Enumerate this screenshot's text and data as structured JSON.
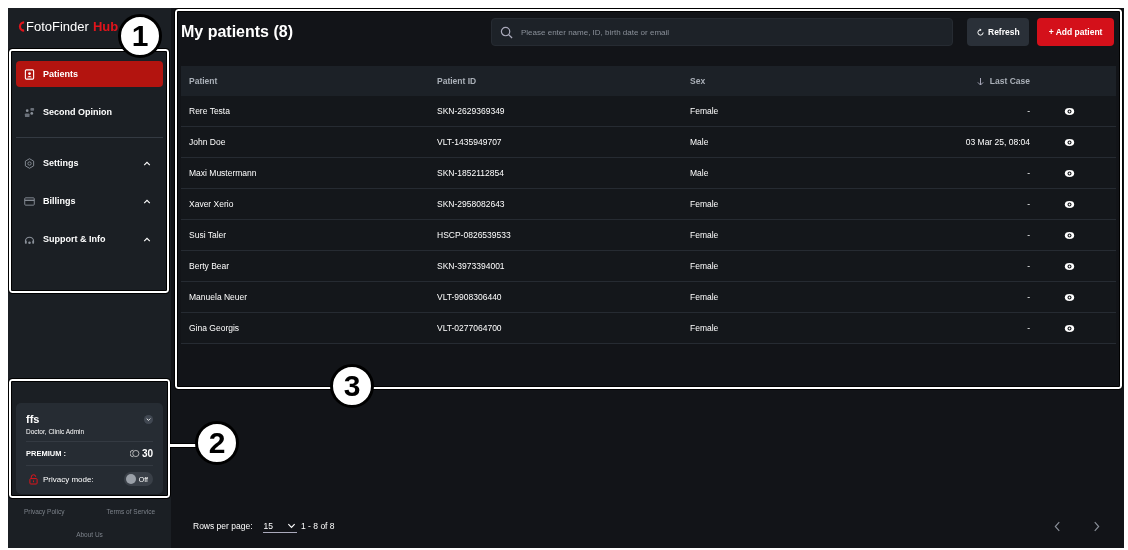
{
  "logo": {
    "brand": "FotoFinder",
    "accent": "Hub"
  },
  "nav": [
    {
      "label": "Patients",
      "selected": true,
      "chevron": false
    },
    {
      "label": "Second Opinion",
      "selected": false,
      "chevron": false
    },
    {
      "label": "Settings",
      "selected": false,
      "chevron": true
    },
    {
      "label": "Billings",
      "selected": false,
      "chevron": true
    },
    {
      "label": "Support & Info",
      "selected": false,
      "chevron": true
    }
  ],
  "profile": {
    "name": "ffs",
    "role": "Doctor, Clinic Admin",
    "plan": "PREMIUM :",
    "credits": "30",
    "privacy_label": "Privacy mode:",
    "privacy_on": false,
    "privacy_state": "Off"
  },
  "footer_links": [
    "Privacy Policy",
    "Terms of Service",
    "About Us"
  ],
  "title": "My patients (8)",
  "search": {
    "placeholder": "Please enter name, ID, birth date or email"
  },
  "buttons": {
    "refresh": "Refresh",
    "add": "+ Add patient"
  },
  "table": {
    "columns": [
      "Patient",
      "Patient ID",
      "Sex",
      "Last Case"
    ],
    "rows": [
      {
        "patient": "Rere Testa",
        "id": "SKN-2629369349",
        "sex": "Female",
        "last_case": "-"
      },
      {
        "patient": "John Doe",
        "id": "VLT-1435949707",
        "sex": "Male",
        "last_case": "03 Mar 25, 08:04"
      },
      {
        "patient": "Maxi Mustermann",
        "id": "SKN-1852112854",
        "sex": "Male",
        "last_case": "-"
      },
      {
        "patient": "Xaver Xerio",
        "id": "SKN-2958082643",
        "sex": "Female",
        "last_case": "-"
      },
      {
        "patient": "Susi Taler",
        "id": "HSCP-0826539533",
        "sex": "Female",
        "last_case": "-"
      },
      {
        "patient": "Berty Bear",
        "id": "SKN-3973394001",
        "sex": "Female",
        "last_case": "-"
      },
      {
        "patient": "Manuela Neuer",
        "id": "VLT-9908306440",
        "sex": "Female",
        "last_case": "-"
      },
      {
        "patient": "Gina Georgis",
        "id": "VLT-0277064700",
        "sex": "Female",
        "last_case": "-"
      }
    ]
  },
  "pagination": {
    "rows_label": "Rows per page:",
    "rows_value": "15",
    "range": "1 - 8 of 8"
  },
  "callouts": [
    {
      "label": "1"
    },
    {
      "label": "2"
    },
    {
      "label": "3"
    }
  ]
}
